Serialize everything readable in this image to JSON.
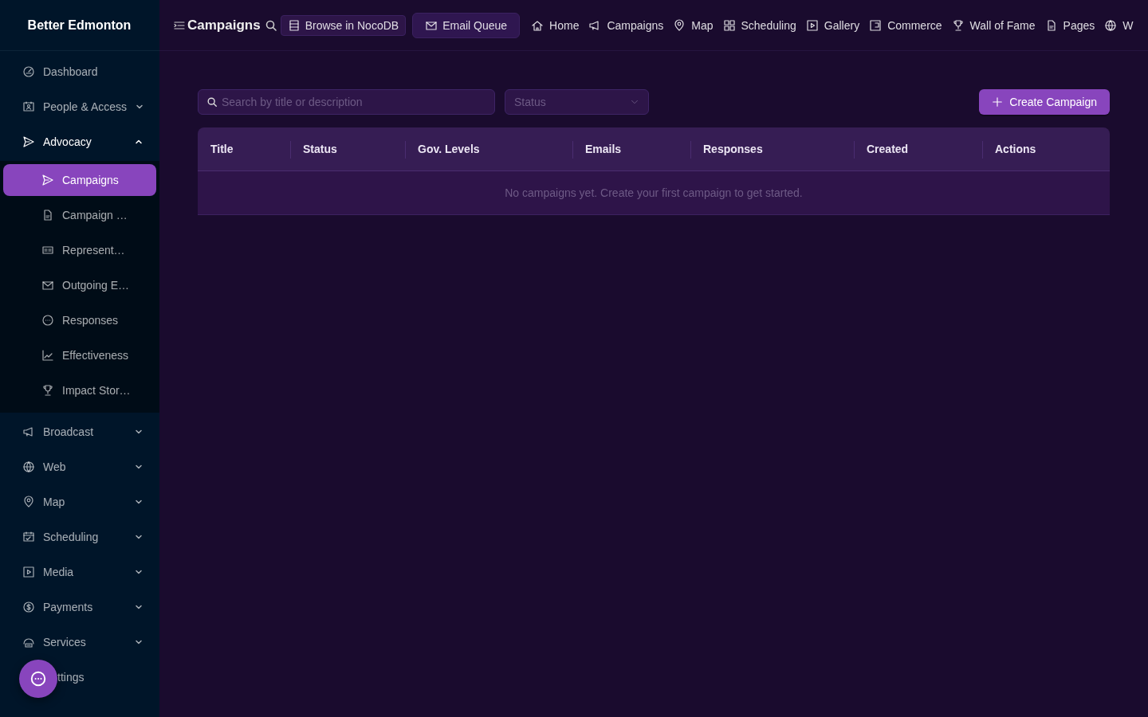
{
  "sidebar": {
    "brand": "Better Edmonton",
    "items": [
      {
        "label": "Dashboard",
        "kind": "item"
      },
      {
        "label": "People & Access",
        "kind": "group",
        "expanded": false
      },
      {
        "label": "Advocacy",
        "kind": "group",
        "expanded": true,
        "children": [
          {
            "label": "Campaigns",
            "selected": true
          },
          {
            "label": "Campaign …",
            "selected": false
          },
          {
            "label": "Represent…",
            "selected": false
          },
          {
            "label": "Outgoing E…",
            "selected": false
          },
          {
            "label": "Responses",
            "selected": false
          },
          {
            "label": "Effectiveness",
            "selected": false
          },
          {
            "label": "Impact Stor…",
            "selected": false
          }
        ]
      },
      {
        "label": "Broadcast",
        "kind": "group",
        "expanded": false
      },
      {
        "label": "Web",
        "kind": "group",
        "expanded": false
      },
      {
        "label": "Map",
        "kind": "group",
        "expanded": false
      },
      {
        "label": "Scheduling",
        "kind": "group",
        "expanded": false
      },
      {
        "label": "Media",
        "kind": "group",
        "expanded": false
      },
      {
        "label": "Payments",
        "kind": "group",
        "expanded": false
      },
      {
        "label": "Services",
        "kind": "group",
        "expanded": false
      },
      {
        "label": "ttings",
        "kind": "covered"
      }
    ]
  },
  "header": {
    "title": "Campaigns",
    "buttons": [
      "Browse in NocoDB",
      "Email Queue"
    ],
    "links": [
      "Home",
      "Campaigns",
      "Map",
      "Scheduling",
      "Gallery",
      "Commerce",
      "Wall of Fame",
      "Pages",
      "W"
    ]
  },
  "toolbar": {
    "search": {
      "placeholder": "Search by title or description"
    },
    "status_filter": {
      "placeholder": "Status"
    },
    "create_button": "Create Campaign"
  },
  "table": {
    "columns": [
      "Title",
      "Status",
      "Gov. Levels",
      "Emails",
      "Responses",
      "Created",
      "Actions"
    ],
    "empty_text": "No campaigns yet. Create your first campaign to get started."
  }
}
